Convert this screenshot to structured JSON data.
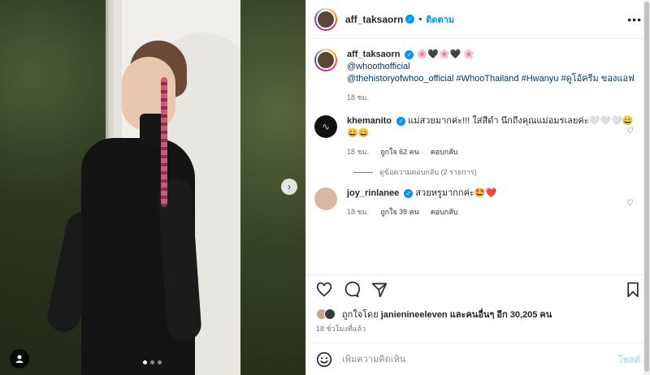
{
  "post": {
    "username": "aff_taksaorn",
    "separator": "•",
    "follow_label": "ติดตาม",
    "more_label": "•••",
    "caption_emojis": "🌸🖤🌸🖤 🌸",
    "caption_lines": [
      "@whoothofficial",
      "@thehistoryofwhoo_official #WhooThailand #Hwanyu #ดูโอ้ครีม ของแอฟ"
    ],
    "caption_time": "18 ชม."
  },
  "comments": [
    {
      "username": "khemanito",
      "text": "แม่สวยมากค่ะ!!! ใส่สีดำ นึกถึงคุณแม่อมรเลยค่ะ🤍🤍🤍😄😄😄",
      "time": "18 ชม.",
      "likes": "ถูกใจ 62 คน",
      "reply_label": "ตอบกลับ",
      "view_replies": "ดูข้อความตอบกลับ (2 รายการ)"
    },
    {
      "username": "joy_rinlanee",
      "text": "สวยหรูมากกค่ะ🤩❤️",
      "time": "18 ชม.",
      "likes": "ถูกใจ 39 คน",
      "reply_label": "ตอบกลับ"
    }
  ],
  "likes": {
    "prefix": "ถูกใจโดย",
    "user": "janienineeleven",
    "suffix": "และคนอื่นๆ อีก 30,205 คน"
  },
  "timestamp": "18 ชั่วโมงที่แล้ว",
  "compose": {
    "placeholder": "เพิ่มความคิดเห็น",
    "post_label": "โพสต์"
  },
  "carousel": {
    "current": 1,
    "total": 3
  },
  "icons": {
    "heart": "heart-icon",
    "comment": "comment-icon",
    "share": "share-icon",
    "save": "bookmark-icon",
    "emoji": "emoji-icon",
    "more": "more-icon"
  },
  "colors": {
    "accent": "#0095f6",
    "verified": "#0095f6",
    "link": "#00376b"
  }
}
